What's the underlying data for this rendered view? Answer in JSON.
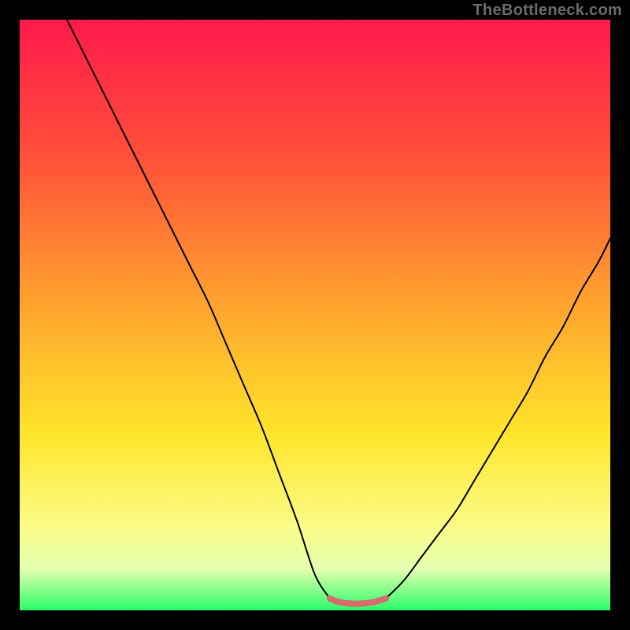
{
  "watermark": "TheBottleneck.com",
  "chart_data": {
    "type": "line",
    "title": "",
    "xlabel": "",
    "ylabel": "",
    "xlim": [
      0,
      100
    ],
    "ylim": [
      0,
      100
    ],
    "grid": false,
    "legend": false,
    "gradient_stops": [
      {
        "offset": 0,
        "color": "#ff1a4b"
      },
      {
        "offset": 23,
        "color": "#ff4f39"
      },
      {
        "offset": 48,
        "color": "#ffa32e"
      },
      {
        "offset": 70,
        "color": "#ffe52a"
      },
      {
        "offset": 86,
        "color": "#fbfc88"
      },
      {
        "offset": 93,
        "color": "#e4ffb0"
      },
      {
        "offset": 100,
        "color": "#2bff6a"
      }
    ],
    "series": [
      {
        "name": "black-curve-left",
        "color": "#000000",
        "width": 2,
        "x": [
          8,
          11,
          14,
          17,
          20,
          23,
          26,
          29,
          32,
          35,
          38,
          41,
          44,
          47,
          50,
          52.5
        ],
        "y": [
          100,
          94,
          88,
          82,
          76,
          70,
          64,
          58,
          52,
          45,
          38,
          31,
          23,
          15,
          6,
          2
        ]
      },
      {
        "name": "black-curve-right",
        "color": "#000000",
        "width": 2,
        "x": [
          62,
          65,
          68,
          71,
          74,
          77,
          80,
          83,
          86,
          89,
          92,
          95,
          98,
          100
        ],
        "y": [
          2,
          5,
          9,
          13,
          17,
          22,
          27,
          32,
          37,
          43,
          48,
          54,
          59,
          63
        ]
      },
      {
        "name": "red-bottom-segment",
        "color": "#d86b6b",
        "width": 8,
        "x": [
          52.5,
          54,
          55.5,
          57,
          58.5,
          60,
          61,
          62
        ],
        "y": [
          2.0,
          1.4,
          1.2,
          1.1,
          1.2,
          1.4,
          1.7,
          2.0
        ]
      }
    ]
  }
}
